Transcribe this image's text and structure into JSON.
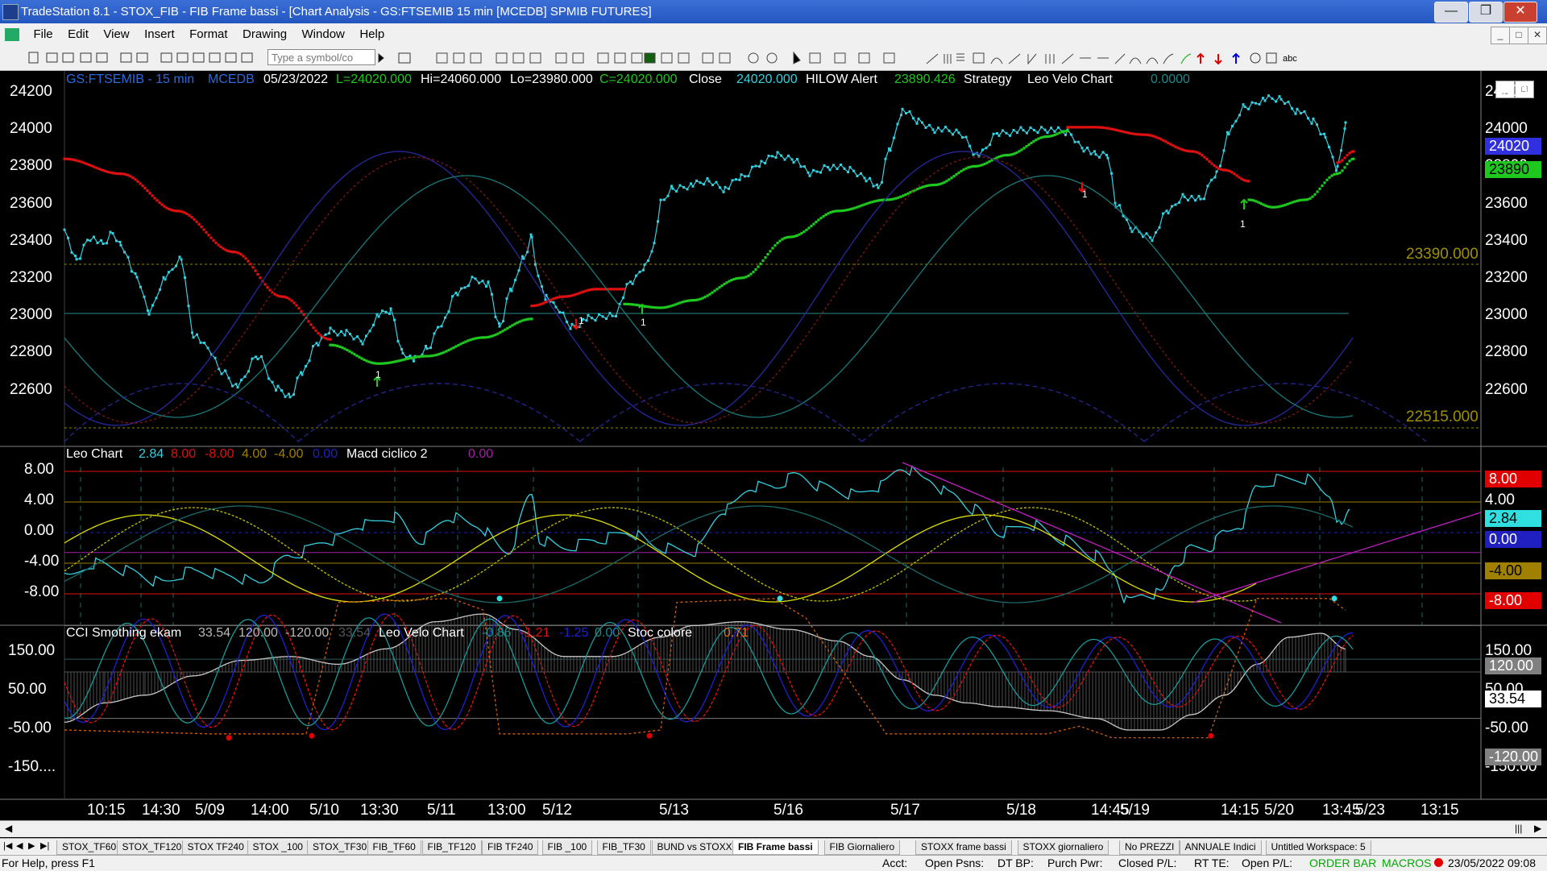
{
  "window": {
    "title": "TradeStation 8.1 - STOX_FIB - FIB Frame bassi - [Chart Analysis - GS:FTSEMIB  15 min  [MCEDB] SPMIB FUTURES]"
  },
  "menu": [
    "File",
    "Edit",
    "View",
    "Insert",
    "Format",
    "Drawing",
    "Window",
    "Help"
  ],
  "toolbar": {
    "symbol_placeholder": "Type a symbol/co"
  },
  "chart_header": {
    "symbol": "GS:FTSEMIB - 15 min",
    "exchange": "MCEDB",
    "date": "05/23/2022",
    "last": "L=24020.000",
    "high": "Hi=24060.000",
    "low": "Lo=23980.000",
    "close_eq": "C=24020.000",
    "close_word": "Close",
    "close_val": "24020.000",
    "hilow": "HILOW Alert",
    "hilow_val": "23890.426",
    "strategy": "Strategy",
    "leo": "Leo Velo Chart",
    "leo_val": "0.0000"
  },
  "panel2_header": {
    "name": "Leo Chart",
    "v1": "2.84",
    "v2": "8.00",
    "v3": "-8.00",
    "v4": "4.00",
    "v5": "-4.00",
    "v6": "0.00",
    "macd": "Macd ciclico 2",
    "macd_val": "0.00"
  },
  "panel3_header": {
    "name": "CCI Smothing ekam",
    "v1": "33.54",
    "v2": "120.00",
    "v3": "-120.00",
    "v4": "33.54",
    "leo": "Leo Velo Chart",
    "l1": "-0.86",
    "l2": "-1.21",
    "l3": "-1.25",
    "l4": "0.00",
    "stoc": "Stoc colore",
    "stoc_val": "0.71"
  },
  "price_axis": [
    "24200",
    "24000",
    "23800",
    "23600",
    "23400",
    "23200",
    "23000",
    "22800",
    "22600"
  ],
  "price_boxes": {
    "last": "24020",
    "hilow": "23890",
    "level_hi": "23390.000",
    "level_lo": "22515.000"
  },
  "leo_axis": [
    "8.00",
    "4.00",
    "0.00",
    "-4.00",
    "-8.00"
  ],
  "leo_boxes": {
    "top": "8.00",
    "val": "2.84",
    "zero": "0.00",
    "neg4": "-4.00",
    "neg8": "-8.00"
  },
  "cci_axis": [
    "150.00",
    "50.00",
    "-50.00",
    "-150...."
  ],
  "cci_right_axis": [
    "150.00",
    "50.00",
    "-50.00",
    "-150.00"
  ],
  "cci_boxes": {
    "b120": "120.00",
    "b3354": "33.54",
    "bneg120": "-120.00"
  },
  "time_axis": [
    "10:15",
    "14:30",
    "5/09",
    "14:00",
    "5/10",
    "13:30",
    "5/11",
    "13:00",
    "5/12",
    "5/13",
    "5/16",
    "5/17",
    "5/18",
    "14:45",
    "5/19",
    "14:15",
    "5/20",
    "13:45",
    "5/23",
    "13:15"
  ],
  "signal_labels": [
    "1",
    "1",
    "1",
    "1",
    "1"
  ],
  "tabs": [
    "STOX_TF60",
    "STOX_TF120",
    "STOX TF240",
    "STOX _100",
    "STOX_TF30",
    "FIB_TF60",
    "FIB_TF120",
    "FIB TF240",
    "FIB _100",
    "FIB_TF30",
    "BUND vs STOXX",
    "FIB Frame bassi",
    "FIB Giornaliero",
    "STOXX frame bassi",
    "STOXX giornaliero",
    "No PREZZI",
    "ANNUALE Indici",
    "Untitled Workspace: 5"
  ],
  "status": {
    "help": "For Help, press F1",
    "acct": "Acct:",
    "open_psns": "Open Psns:",
    "dt_bp": "DT BP:",
    "purch_pwr": "Purch Pwr:",
    "closed_pl": "Closed P/L:",
    "rt_te": "RT TE:",
    "open_pl": "Open P/L:",
    "order_bar": "ORDER BAR",
    "macros": "MACROS",
    "datetime": "23/05/2022 09:08"
  },
  "colors": {
    "cyan": "#35d0e0",
    "green": "#1ec81e",
    "red": "#e01010",
    "yellow": "#e0e000",
    "navy": "#2020c0",
    "magenta": "#c020c0"
  }
}
